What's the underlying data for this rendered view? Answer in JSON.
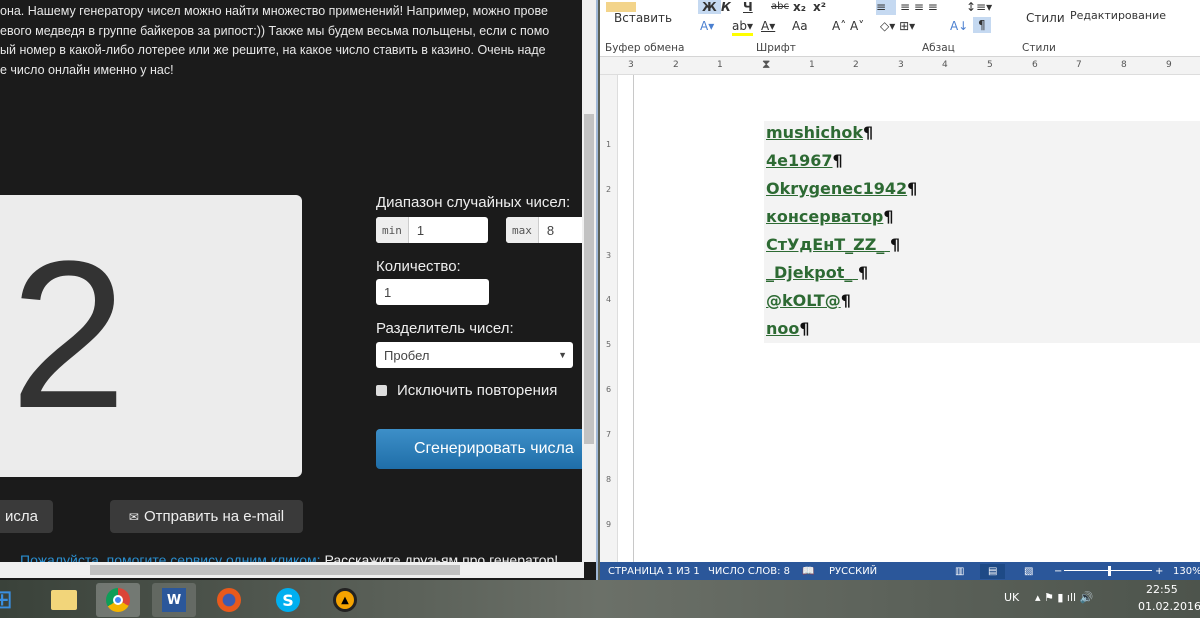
{
  "browser": {
    "intro_lines": [
      "она. Нашему генератору чисел можно найти множество применений! Например, можно прове",
      "евого медведя в группе байкеров за рипост:)) Также мы будем весьма польщены, если с помо",
      "ый номер в какой-либо лотерее или же решите, на какое число ставить в казино. Очень наде",
      "е число онлайн именно у нас!"
    ],
    "result": "2",
    "range_label": "Диапазон случайных чисел:",
    "min_label": "min",
    "min_value": "1",
    "max_label": "max",
    "max_value": "8",
    "count_label": "Количество:",
    "count_value": "1",
    "separator_label": "Разделитель чисел:",
    "separator_value": "Пробел",
    "exclude_label": "Исключить повторения",
    "generate_button": "Сгенерировать числа",
    "copy_button": "исла",
    "email_button": "Отправить на e-mail",
    "help_link": "Пожалуйста, помогите сервису одним кликом:",
    "share_text": "Расскажите друзьям про генератор!"
  },
  "word": {
    "ribbon": {
      "paste": "Вставить",
      "clipboard": "Буфер обмена",
      "font": "Шрифт",
      "paragraph": "Абзац",
      "styles_btn": "Стили",
      "styles": "Стили",
      "editing": "Редактирование",
      "bold": "Ж",
      "italic": "К",
      "underline": "Ч",
      "strike": "abc",
      "sub": "x₂",
      "sup": "x²",
      "case": "Aa",
      "pilcrow": "¶"
    },
    "ruler": [
      "3",
      "2",
      "1",
      "1",
      "2",
      "3",
      "4",
      "5",
      "6",
      "7",
      "8",
      "9"
    ],
    "vruler": [
      "1",
      "2",
      "3",
      "4",
      "5",
      "6",
      "7",
      "8",
      "9"
    ],
    "lines": [
      "mushichok",
      "4e1967",
      "Okrygenec1942",
      "консерватор",
      "СтУдЕнТ_ZZ_",
      "_Djekpot_",
      "@kOLT@",
      "noo"
    ],
    "pilcrow": "¶",
    "status": {
      "page": "СТРАНИЦА 1 ИЗ 1",
      "words": "ЧИСЛО СЛОВ: 8",
      "lang": "РУССКИЙ",
      "zoom": "130%"
    },
    "zoom_percent": 130
  },
  "taskbar": {
    "lang": "UK",
    "time": "22:55",
    "date": "01.02.2016"
  }
}
